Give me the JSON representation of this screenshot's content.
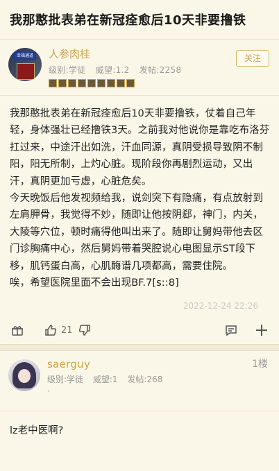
{
  "thread": {
    "title": "我那憨批表弟在新冠痊愈后10天非要撸铁"
  },
  "post": {
    "author": {
      "name": "人参肉桂",
      "level": "级别:学徒",
      "reputation": "威望:1.2",
      "posts": "发帖:2258",
      "avatar_sign": "幸福通道"
    },
    "follow_label": "关注",
    "paragraphs": [
      "我那憨批表弟在新冠痊愈后10天非要撸铁，仗着自己年轻，身体强壮已经撸铁3天。之前我对他说你是靠吃布洛芬扛过来，中途汗出如洗，汗血同源，真阴受损导致阴不制阳，阳无所制，上灼心脏。现阶段你再剧烈运动，又出汗，真阴更加亏虚，心脏危矣。",
      "今天晚饭后他发视频给我，说剑突下有隐痛，有点放射到左肩胛骨，我觉得不妙，随即让他按阴郄，神门，内关，大陵等穴位，顿时痛得他叫出来了。随即让舅妈带他去区门诊胸痛中心，然后舅妈带着哭腔说心电图显示ST段下移，肌钙蛋白高，心肌酶谱几项都高，需要住院。",
      "唉，希望医院里面不会出现BF.7[s::8]"
    ],
    "timestamp": "2022-12-24 22:26",
    "like_count": "21"
  },
  "reply": {
    "author": {
      "name": "saerguy",
      "level": "级别:学徒",
      "reputation": "威望:1",
      "posts": "发帖:268"
    },
    "dot": "·",
    "floor": "1楼",
    "text": "lz老中医啊?"
  },
  "colors": {
    "background": "#fbf7e8",
    "accent_gold": "#c9a24a",
    "muted": "#999999"
  }
}
